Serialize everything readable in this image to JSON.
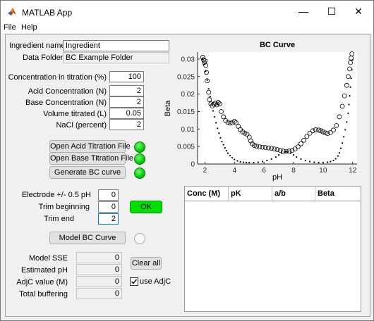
{
  "window": {
    "title": "MATLAB App",
    "icons": {
      "app": "matlab-logo-icon",
      "minimize": "minimize-icon",
      "maximize": "maximize-icon",
      "close": "close-icon"
    },
    "glyphs": {
      "minimize": "—",
      "maximize": "☐",
      "close": "✕"
    }
  },
  "menu": {
    "file": "File",
    "help": "Help"
  },
  "fields": {
    "ingredient_name_label": "Ingredient name",
    "ingredient_name_value": "Ingredient",
    "data_folder_label": "Data Folder",
    "data_folder_value": "BC Example Folder",
    "concentration_label": "Concentration in titration (%)",
    "concentration_value": "100",
    "acid_label": "Acid Concentration (N)",
    "acid_value": "2",
    "base_label": "Base Concentration (N)",
    "base_value": "2",
    "volume_label": "Volume titrated (L)",
    "volume_value": "0.05",
    "nacl_label": "NaCl (percent)",
    "nacl_value": "2"
  },
  "buttons": {
    "open_acid": "Open Acid Titration File",
    "open_base": "Open Base Titration File",
    "generate": "Generate BC curve",
    "ok": "OK",
    "model": "Model BC Curve",
    "clear_all": "Clear all"
  },
  "lamps": {
    "acid": "on",
    "base": "on",
    "generate": "on",
    "model": "off",
    "colors": {
      "on": "#08c808",
      "off": "#f7f7f7"
    }
  },
  "trim": {
    "electrode_label": "Electrode +/- 0.5 pH",
    "electrode_value": "0",
    "trim_beginning_label": "Trim beginning",
    "trim_beginning_value": "0",
    "trim_end_label": "Trim end",
    "trim_end_value": "2"
  },
  "model": {
    "sse_label": "Model SSE",
    "sse_value": "0",
    "estimated_ph_label": "Estimated pH",
    "estimated_ph_value": "0",
    "adjc_label": "AdjC value (M)",
    "adjc_value": "0",
    "total_buffering_label": "Total buffering",
    "total_buffering_value": "0",
    "use_adjc_label": "use AdjC",
    "use_adjc_checked": true
  },
  "table": {
    "columns": [
      "Conc (M)",
      "pK",
      "a/b",
      "Beta"
    ],
    "rows": []
  },
  "chart_data": {
    "type": "scatter",
    "title": "BC Curve",
    "xlabel": "pH",
    "ylabel": "Beta",
    "xlim": [
      1.5,
      12.3
    ],
    "ylim": [
      0,
      0.032
    ],
    "xticks": [
      2,
      4,
      6,
      8,
      10,
      12
    ],
    "yticks": [
      0,
      0.005,
      0.01,
      0.015,
      0.02,
      0.025,
      0.03
    ],
    "grid": false,
    "series": [
      {
        "marker": "open-circle",
        "points": [
          [
            1.85,
            0.0305
          ],
          [
            1.9,
            0.0298
          ],
          [
            1.95,
            0.029
          ],
          [
            2.0,
            0.0295
          ],
          [
            2.05,
            0.0282
          ],
          [
            2.1,
            0.0262
          ],
          [
            2.15,
            0.0238
          ],
          [
            2.25,
            0.0205
          ],
          [
            2.3,
            0.0184
          ],
          [
            2.4,
            0.0172
          ],
          [
            2.5,
            0.0166
          ],
          [
            2.6,
            0.0171
          ],
          [
            2.7,
            0.0174
          ],
          [
            2.8,
            0.0169
          ],
          [
            2.9,
            0.0176
          ],
          [
            3.0,
            0.0172
          ],
          [
            3.1,
            0.015
          ],
          [
            3.25,
            0.0135
          ],
          [
            3.4,
            0.0124
          ],
          [
            3.55,
            0.0119
          ],
          [
            3.7,
            0.0117
          ],
          [
            3.85,
            0.0118
          ],
          [
            4.0,
            0.0122
          ],
          [
            4.1,
            0.0118
          ],
          [
            4.25,
            0.0108
          ],
          [
            4.4,
            0.0098
          ],
          [
            4.55,
            0.0092
          ],
          [
            4.7,
            0.0088
          ],
          [
            4.85,
            0.0085
          ],
          [
            5.0,
            0.0077
          ],
          [
            5.1,
            0.0066
          ],
          [
            5.2,
            0.0058
          ],
          [
            5.35,
            0.0053
          ],
          [
            5.5,
            0.0051
          ],
          [
            5.7,
            0.0049
          ],
          [
            5.9,
            0.0048
          ],
          [
            6.1,
            0.0047
          ],
          [
            6.3,
            0.0046
          ],
          [
            6.5,
            0.0045
          ],
          [
            6.7,
            0.0043
          ],
          [
            6.9,
            0.0041
          ],
          [
            7.1,
            0.0039
          ],
          [
            7.3,
            0.0037
          ],
          [
            7.5,
            0.0036
          ],
          [
            7.7,
            0.0037
          ],
          [
            7.9,
            0.0039
          ],
          [
            8.1,
            0.0043
          ],
          [
            8.3,
            0.0049
          ],
          [
            8.5,
            0.0058
          ],
          [
            8.7,
            0.0068
          ],
          [
            8.9,
            0.0079
          ],
          [
            9.1,
            0.0088
          ],
          [
            9.3,
            0.0095
          ],
          [
            9.5,
            0.0098
          ],
          [
            9.7,
            0.0097
          ],
          [
            9.85,
            0.0095
          ],
          [
            10.0,
            0.0092
          ],
          [
            10.15,
            0.0089
          ],
          [
            10.3,
            0.0087
          ],
          [
            10.5,
            0.009
          ],
          [
            10.7,
            0.0097
          ],
          [
            10.9,
            0.011
          ],
          [
            11.1,
            0.0135
          ],
          [
            11.3,
            0.0165
          ],
          [
            11.45,
            0.0195
          ],
          [
            11.6,
            0.0225
          ],
          [
            11.7,
            0.025
          ],
          [
            11.8,
            0.0272
          ],
          [
            11.85,
            0.029
          ],
          [
            11.9,
            0.0303
          ],
          [
            11.95,
            0.0315
          ]
        ]
      },
      {
        "marker": "dot",
        "points": [
          [
            1.85,
            0.03
          ],
          [
            1.95,
            0.0285
          ],
          [
            2.05,
            0.0265
          ],
          [
            2.15,
            0.024
          ],
          [
            2.25,
            0.0215
          ],
          [
            2.35,
            0.0193
          ],
          [
            2.45,
            0.0172
          ],
          [
            2.55,
            0.0152
          ],
          [
            2.65,
            0.0135
          ],
          [
            2.75,
            0.0118
          ],
          [
            2.85,
            0.0102
          ],
          [
            2.95,
            0.0088
          ],
          [
            3.05,
            0.0075
          ],
          [
            3.15,
            0.0064
          ],
          [
            3.25,
            0.0055
          ],
          [
            3.35,
            0.0046
          ],
          [
            3.45,
            0.0038
          ],
          [
            3.55,
            0.0031
          ],
          [
            3.7,
            0.0024
          ],
          [
            3.85,
            0.0018
          ],
          [
            4.0,
            0.0013
          ],
          [
            4.2,
            0.0009
          ],
          [
            4.4,
            0.0006
          ],
          [
            4.6,
            0.0005
          ],
          [
            4.8,
            0.0004
          ],
          [
            5.0,
            0.0004
          ],
          [
            5.3,
            0.0004
          ],
          [
            5.6,
            0.0005
          ],
          [
            5.9,
            0.0007
          ],
          [
            6.2,
            0.001
          ],
          [
            6.5,
            0.0014
          ],
          [
            6.8,
            0.002
          ],
          [
            7.0,
            0.0026
          ],
          [
            7.2,
            0.0031
          ],
          [
            7.4,
            0.0034
          ],
          [
            7.5,
            0.0035
          ],
          [
            7.6,
            0.0034
          ],
          [
            7.8,
            0.0031
          ],
          [
            8.0,
            0.0026
          ],
          [
            8.2,
            0.002
          ],
          [
            8.5,
            0.0014
          ],
          [
            8.8,
            0.001
          ],
          [
            9.1,
            0.0007
          ],
          [
            9.4,
            0.0005
          ],
          [
            9.7,
            0.0004
          ],
          [
            10.0,
            0.0004
          ],
          [
            10.3,
            0.0005
          ],
          [
            10.5,
            0.0007
          ],
          [
            10.7,
            0.001
          ],
          [
            10.85,
            0.0015
          ],
          [
            11.0,
            0.0023
          ],
          [
            11.1,
            0.0032
          ],
          [
            11.2,
            0.0045
          ],
          [
            11.3,
            0.006
          ],
          [
            11.4,
            0.0078
          ],
          [
            11.5,
            0.0098
          ],
          [
            11.6,
            0.012
          ],
          [
            11.7,
            0.0145
          ],
          [
            11.75,
            0.017
          ],
          [
            11.8,
            0.0195
          ],
          [
            11.85,
            0.022
          ],
          [
            11.9,
            0.0245
          ],
          [
            11.95,
            0.027
          ],
          [
            12.0,
            0.0298
          ]
        ]
      }
    ]
  }
}
